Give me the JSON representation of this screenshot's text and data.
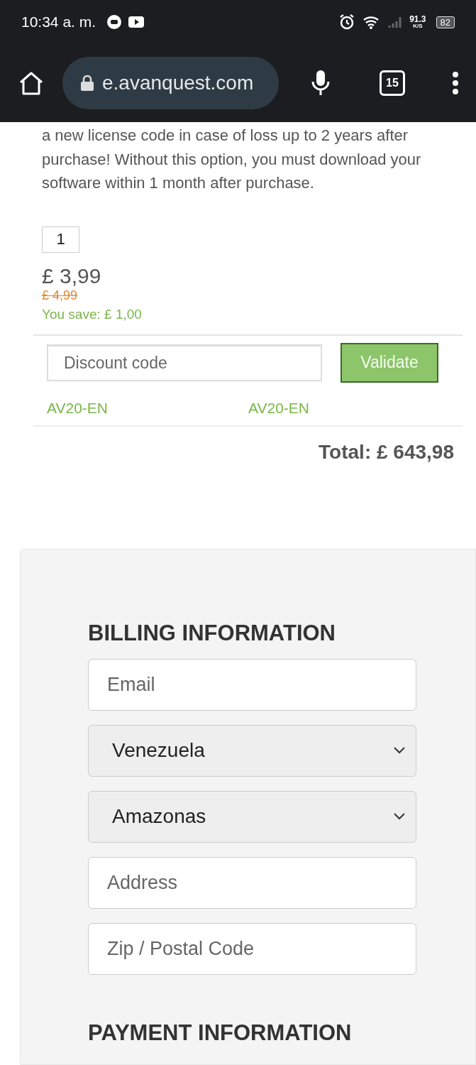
{
  "status_bar": {
    "time": "10:34 a. m.",
    "net_speed": "91.3",
    "net_unit": "K/S",
    "battery": "82"
  },
  "browser": {
    "url": "e.avanquest.com",
    "tab_count": "15"
  },
  "option_text": "a new license code in case of loss up to 2 years after purchase! Without this option, you must download your software within 1 month after purchase.",
  "quantity": "1",
  "price": "£ 3,99",
  "old_price": "£ 4,99",
  "savings": "You save: £ 1,00",
  "discount": {
    "placeholder": "Discount code",
    "button": "Validate",
    "codes": [
      "AV20-EN",
      "AV20-EN"
    ]
  },
  "total": "Total: £ 643,98",
  "billing": {
    "heading": "BILLING INFORMATION",
    "fields": [
      {
        "kind": "input",
        "placeholder": "Email"
      },
      {
        "kind": "select",
        "value": "Venezuela"
      },
      {
        "kind": "select",
        "value": "Amazonas"
      },
      {
        "kind": "input",
        "placeholder": "Address"
      },
      {
        "kind": "input",
        "placeholder": "Zip / Postal Code"
      }
    ]
  },
  "payment": {
    "heading": "PAYMENT INFORMATION"
  }
}
